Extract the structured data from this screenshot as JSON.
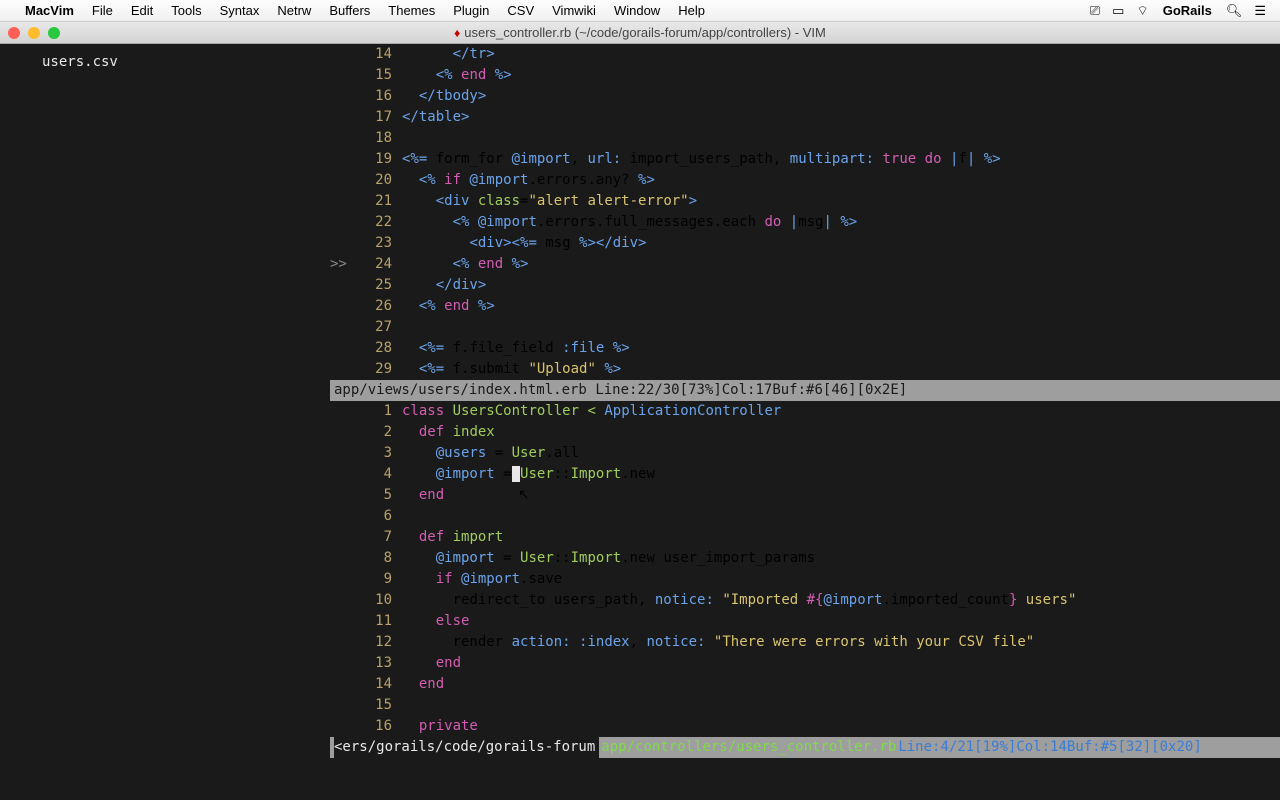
{
  "menubar": {
    "app_name": "MacVim",
    "items": [
      "File",
      "Edit",
      "Tools",
      "Syntax",
      "Netrw",
      "Buffers",
      "Themes",
      "Plugin",
      "CSV",
      "Vimwiki",
      "Window",
      "Help"
    ],
    "brand": "GoRails"
  },
  "window": {
    "title": "users_controller.rb (~/code/gorails-forum/app/controllers) - VIM"
  },
  "sidebar": {
    "file": "users.csv"
  },
  "pane_top": {
    "lines": [
      {
        "n": 14,
        "html": "      <span class='k-blue'>&lt;/tr&gt;</span>"
      },
      {
        "n": 15,
        "html": "    <span class='k-blue'>&lt;%</span> <span class='k-mag'>end</span> <span class='k-blue'>%&gt;</span>"
      },
      {
        "n": 16,
        "html": "  <span class='k-blue'>&lt;/tbody&gt;</span>"
      },
      {
        "n": 17,
        "html": "<span class='k-blue'>&lt;/table&gt;</span>"
      },
      {
        "n": 18,
        "html": ""
      },
      {
        "n": 19,
        "html": "<span class='k-blue'>&lt;%=</span> form_for <span class='k-blue'>@import</span>, <span class='k-blue'>url:</span> import_users_path, <span class='k-blue'>multipart:</span> <span class='k-mag'>true</span> <span class='k-mag'>do</span> <span class='k-blue'>|</span>f<span class='k-blue'>|</span> <span class='k-blue'>%&gt;</span>"
      },
      {
        "n": 20,
        "html": "  <span class='k-blue'>&lt;%</span> <span class='k-mag'>if</span> <span class='k-blue'>@import</span>.errors.any? <span class='k-blue'>%&gt;</span>"
      },
      {
        "n": 21,
        "html": "    <span class='k-blue'>&lt;div</span> <span class='k-green'>class</span>=<span class='k-yellow'>\"alert alert-error\"</span><span class='k-blue'>&gt;</span>"
      },
      {
        "n": 22,
        "html": "      <span class='k-blue'>&lt;%</span> <span class='k-blue'>@import</span>.errors.full_messages.each <span class='k-mag'>do</span> <span class='k-blue'>|</span>msg<span class='k-blue'>|</span> <span class='k-blue'>%&gt;</span>"
      },
      {
        "n": 23,
        "html": "        <span class='k-blue'>&lt;div&gt;&lt;%=</span> msg <span class='k-blue'>%&gt;&lt;/div&gt;</span>"
      },
      {
        "n": 24,
        "html": "      <span class='k-blue'>&lt;%</span> <span class='k-mag'>end</span> <span class='k-blue'>%&gt;</span>",
        "mark": ">>"
      },
      {
        "n": 25,
        "html": "    <span class='k-blue'>&lt;/div&gt;</span>"
      },
      {
        "n": 26,
        "html": "  <span class='k-blue'>&lt;%</span> <span class='k-mag'>end</span> <span class='k-blue'>%&gt;</span>"
      },
      {
        "n": 27,
        "html": ""
      },
      {
        "n": 28,
        "html": "  <span class='k-blue'>&lt;%=</span> f.file_field <span class='k-blue'>:file</span> <span class='k-blue'>%&gt;</span>"
      },
      {
        "n": 29,
        "html": "  <span class='k-blue'>&lt;%=</span> f.submit <span class='k-yellow'>\"Upload\"</span> <span class='k-blue'>%&gt;</span>"
      }
    ],
    "status": {
      "path": "app/views/users/index.html.erb",
      "info": "Line:22/30[73%]Col:17Buf:#6[46][0x2E]"
    }
  },
  "pane_bottom": {
    "lines": [
      {
        "n": 1,
        "html": "<span class='k-mag'>class</span> <span class='k-green'>UsersController</span> <span class='k-green'>&lt;</span> <span class='k-blue'>ApplicationController</span>"
      },
      {
        "n": 2,
        "html": "  <span class='k-mag'>def</span> <span class='k-green'>index</span>"
      },
      {
        "n": 3,
        "html": "    <span class='k-blue'>@users</span> = <span class='k-green'>User</span>.all"
      },
      {
        "n": 4,
        "html": "    <span class='k-blue'>@import</span> =<span class='cursor-block'> </span><span class='k-green'>User</span>::<span class='k-green'>Import</span>.new"
      },
      {
        "n": 5,
        "html": "  <span class='k-mag'>end</span>"
      },
      {
        "n": 6,
        "html": ""
      },
      {
        "n": 7,
        "html": "  <span class='k-mag'>def</span> <span class='k-green'>import</span>"
      },
      {
        "n": 8,
        "html": "    <span class='k-blue'>@import</span> = <span class='k-green'>User</span>::<span class='k-green'>Import</span>.new user_import_params"
      },
      {
        "n": 9,
        "html": "    <span class='k-mag'>if</span> <span class='k-blue'>@import</span>.save"
      },
      {
        "n": 10,
        "html": "      redirect_to users_path, <span class='k-blue'>notice:</span> <span class='k-yellow'>\"Imported </span><span class='k-mag'>#{</span><span class='k-blue'>@import</span>.imported_count<span class='k-mag'>}</span><span class='k-yellow'> users\"</span>"
      },
      {
        "n": 11,
        "html": "    <span class='k-mag'>else</span>"
      },
      {
        "n": 12,
        "html": "      render <span class='k-blue'>action:</span> <span class='k-blue'>:index</span>, <span class='k-blue'>notice:</span> <span class='k-yellow'>\"There were errors with your CSV file\"</span>"
      },
      {
        "n": 13,
        "html": "    <span class='k-mag'>end</span>"
      },
      {
        "n": 14,
        "html": "  <span class='k-mag'>end</span>"
      },
      {
        "n": 15,
        "html": ""
      },
      {
        "n": 16,
        "html": "  <span class='k-mag'>private</span>"
      }
    ],
    "status": {
      "path_left": "<ers/gorails/code/gorails-forum ",
      "path_green": "app/controllers/users_controller.rb",
      "info": "Line:4/21[19%]Col:14Buf:#5[32][0x20]"
    }
  }
}
